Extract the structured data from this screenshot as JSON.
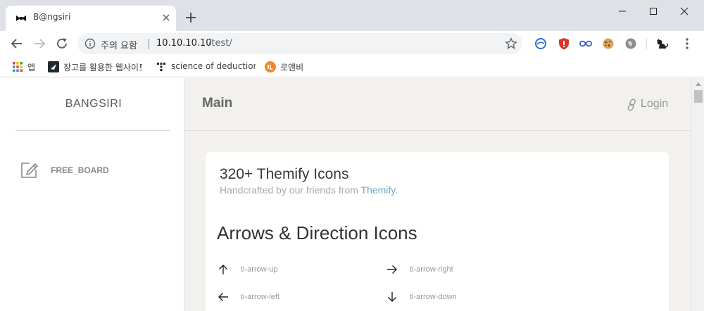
{
  "browser": {
    "tab": {
      "title": "B@ngsiri"
    },
    "omnibox": {
      "security_label": "주의 요함",
      "url_host": "10.10.10.10",
      "url_path": "/test/"
    },
    "bookmarks": [
      {
        "label": "앱",
        "icon": "apps-grid-icon"
      },
      {
        "label": "장고를 활용한 웹사이트",
        "icon": "django-bookmark-icon"
      },
      {
        "label": "science of deduction",
        "icon": "science-bookmark-icon"
      },
      {
        "label": "로앤비",
        "icon": "roaenbi-bookmark-icon"
      }
    ],
    "extensions": [
      "edge-ext-icon",
      "shield-ext-icon",
      "infinity-ext-icon",
      "cookie-ext-icon",
      "globe-ext-icon",
      "cat-ext-icon"
    ]
  },
  "sidebar": {
    "brand": "BANGSIRI",
    "items": [
      {
        "label": "FREE_BOARD",
        "icon": "edit-icon"
      }
    ]
  },
  "header": {
    "title": "Main",
    "login_label": "Login"
  },
  "content": {
    "title": "320+ Themify Icons",
    "subtitle_prefix": "Handcrafted by our friends from ",
    "subtitle_link": "Themify",
    "subtitle_suffix": ".",
    "section_title": "Arrows & Direction Icons",
    "icons": [
      {
        "name": "ti-arrow-up",
        "icon": "arrow-up-icon"
      },
      {
        "name": "ti-arrow-right",
        "icon": "arrow-right-icon"
      },
      {
        "name": "ti-arrow-left",
        "icon": "arrow-left-icon"
      },
      {
        "name": "ti-arrow-down",
        "icon": "arrow-down-icon"
      }
    ]
  },
  "colors": {
    "page_bg": "#f2f1ee",
    "link": "#6fa5c7",
    "tabstrip": "#dee1e6"
  }
}
